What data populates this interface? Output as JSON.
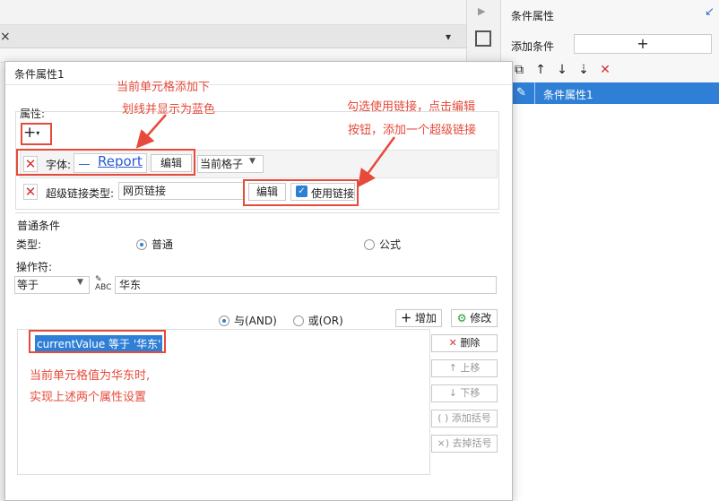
{
  "background": {
    "close_icon": "×",
    "pin_icon": "pin-icon"
  },
  "right_panel": {
    "title": "条件属性",
    "add_condition_label": "添加条件",
    "add_button": "+",
    "toolbar_icons": [
      "copy-icon",
      "arrow-up-icon",
      "arrow-down-icon",
      "sort-icon",
      "delete-icon"
    ],
    "items": [
      {
        "label": "条件属性1",
        "selected": true
      }
    ]
  },
  "dialog": {
    "title": "条件属性1",
    "attributes_label": "属性:",
    "add_attr": "+",
    "font_row": {
      "label": "字体:",
      "preview": "Report",
      "edit": "编辑",
      "apply_to": "当前格子"
    },
    "link_row": {
      "label": "超级链接类型:",
      "value": "网页链接",
      "edit": "编辑",
      "use_link": "使用链接",
      "use_link_checked": true
    },
    "condition": {
      "section_title": "普通条件",
      "type_label": "类型:",
      "type_normal": "普通",
      "type_formula": "公式",
      "selected_type": "普通",
      "operator_label": "操作符:",
      "operator_value": "等于",
      "operand_value": "华东",
      "and_label": "与(AND)",
      "or_label": "或(OR)",
      "add_button": "增加",
      "modify_button": "修改",
      "expressions": [
        "currentValue 等于 '华东'"
      ],
      "side_buttons": {
        "delete": "删除",
        "up": "上移",
        "down": "下移",
        "add_paren": "添加括号",
        "remove_paren": "去掉括号"
      }
    }
  },
  "annotations": {
    "a1_line1": "当前单元格添加下",
    "a1_line2": "划线并显示为蓝色",
    "a2_line1": "勾选使用链接，点击编辑",
    "a2_line2": "按钮，添加一个超级链接",
    "a3_line1": "当前单元格值为华东时,",
    "a3_line2": "实现上述两个属性设置"
  },
  "colors": {
    "accent": "#2f7fd6",
    "annotation": "#e64a3a",
    "delete": "#d43333"
  }
}
